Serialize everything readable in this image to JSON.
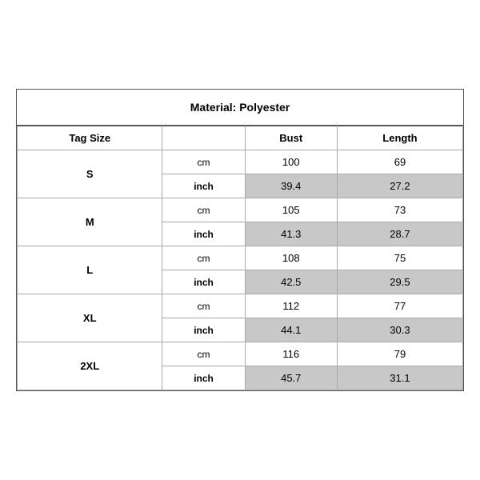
{
  "title": "Material: Polyester",
  "columns": [
    "Tag Size",
    "",
    "Bust",
    "Length"
  ],
  "sizes": [
    {
      "tag": "S",
      "cm": {
        "bust": "100",
        "length": "69"
      },
      "inch": {
        "bust": "39.4",
        "length": "27.2"
      }
    },
    {
      "tag": "M",
      "cm": {
        "bust": "105",
        "length": "73"
      },
      "inch": {
        "bust": "41.3",
        "length": "28.7"
      }
    },
    {
      "tag": "L",
      "cm": {
        "bust": "108",
        "length": "75"
      },
      "inch": {
        "bust": "42.5",
        "length": "29.5"
      }
    },
    {
      "tag": "XL",
      "cm": {
        "bust": "112",
        "length": "77"
      },
      "inch": {
        "bust": "44.1",
        "length": "30.3"
      }
    },
    {
      "tag": "2XL",
      "cm": {
        "bust": "116",
        "length": "79"
      },
      "inch": {
        "bust": "45.7",
        "length": "31.1"
      }
    }
  ],
  "labels": {
    "cm": "cm",
    "inch": "inch",
    "bust": "Bust",
    "length": "Length",
    "tag_size": "Tag Size"
  }
}
